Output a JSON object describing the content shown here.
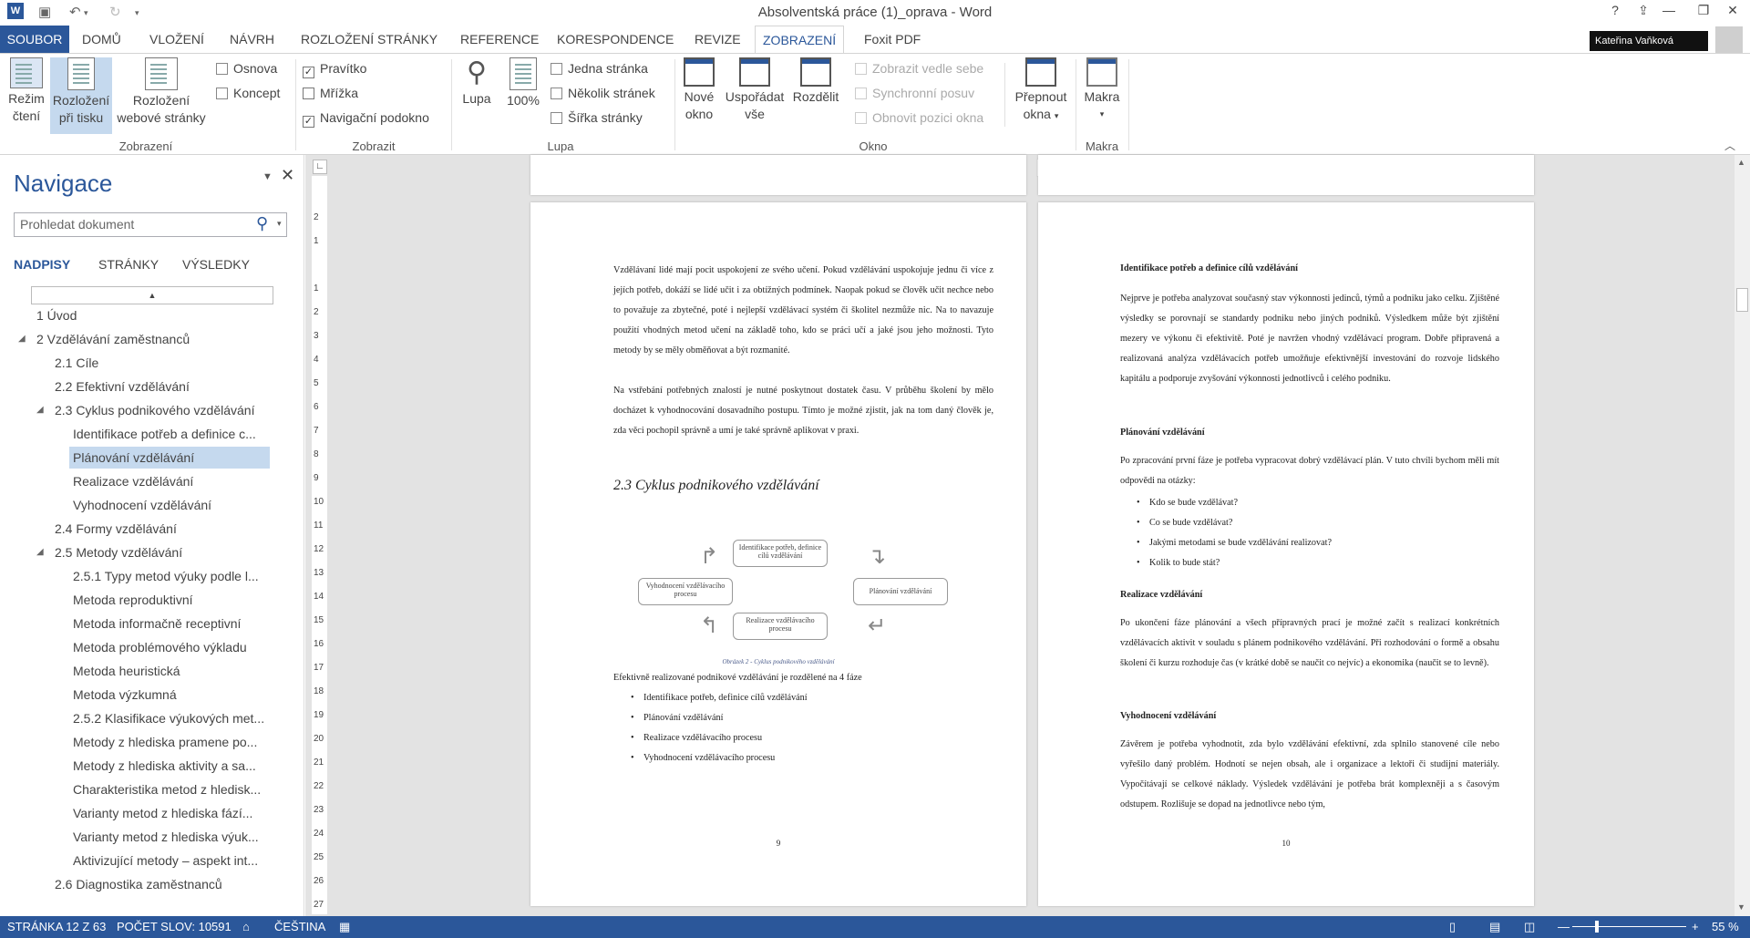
{
  "window": {
    "title": "Absolventská práce (1)_oprava - Word"
  },
  "qat": {
    "undo": "↶",
    "redo": "↻"
  },
  "tabs": [
    "SOUBOR",
    "DOMŮ",
    "VLOŽENÍ",
    "NÁVRH",
    "ROZLOŽENÍ STRÁNKY",
    "REFERENCE",
    "KORESPONDENCE",
    "REVIZE",
    "ZOBRAZENÍ",
    "Foxit PDF"
  ],
  "user": {
    "name": "Kateřina Vaňková"
  },
  "ribbon": {
    "zobrazeni": {
      "read1": "Režim",
      "read2": "čtení",
      "print1": "Rozložení",
      "print2": "při tisku",
      "web1": "Rozložení",
      "web2": "webové stránky",
      "osnova": "Osnova",
      "koncept": "Koncept",
      "label": "Zobrazení"
    },
    "zobrazit": {
      "pravitko": "Pravítko",
      "mrizka": "Mřížka",
      "navig": "Navigační podokno",
      "label": "Zobrazit"
    },
    "lupa": {
      "lupa": "Lupa",
      "pct": "100%",
      "jedna": "Jedna stránka",
      "nekolik": "Několik stránek",
      "sirka": "Šířka stránky",
      "label": "Lupa"
    },
    "okno": {
      "nove1": "Nové",
      "nove2": "okno",
      "usp1": "Uspořádat",
      "usp2": "vše",
      "rozdelit": "Rozdělit",
      "vedle": "Zobrazit vedle sebe",
      "synchro": "Synchronní posuv",
      "obnovit": "Obnovit pozici okna",
      "prep1": "Přepnout",
      "prep2": "okna",
      "label": "Okno"
    },
    "makra": {
      "makra": "Makra",
      "label": "Makra"
    }
  },
  "nav": {
    "title": "Navigace",
    "search_placeholder": "Prohledat dokument",
    "tabs": [
      "NADPISY",
      "STRÁNKY",
      "VÝSLEDKY"
    ],
    "items": [
      {
        "label": "1 Úvod",
        "level": 0
      },
      {
        "label": "2 Vzdělávání zaměstnanců",
        "level": 0
      },
      {
        "label": "2.1 Cíle",
        "level": 1
      },
      {
        "label": "2.2 Efektivní vzdělávání",
        "level": 1
      },
      {
        "label": "2.3 Cyklus podnikového vzdělávání",
        "level": 1
      },
      {
        "label": "Identifikace potřeb a definice c...",
        "level": 2
      },
      {
        "label": "Plánování vzdělávání",
        "level": 2
      },
      {
        "label": "Realizace vzdělávání",
        "level": 2
      },
      {
        "label": "Vyhodnocení vzdělávání",
        "level": 2
      },
      {
        "label": "2.4 Formy vzdělávání",
        "level": 1
      },
      {
        "label": "2.5 Metody vzdělávání",
        "level": 1
      },
      {
        "label": "2.5.1 Typy metod výuky podle l...",
        "level": 2
      },
      {
        "label": "Metoda reproduktivní",
        "level": 2
      },
      {
        "label": "Metoda informačně receptivní",
        "level": 2
      },
      {
        "label": "Metoda problémového výkladu",
        "level": 2
      },
      {
        "label": "Metoda heuristická",
        "level": 2
      },
      {
        "label": "Metoda výzkumná",
        "level": 2
      },
      {
        "label": "2.5.2 Klasifikace výukových met...",
        "level": 2
      },
      {
        "label": "Metody z hlediska pramene po...",
        "level": 2
      },
      {
        "label": "Metody z hlediska aktivity a sa...",
        "level": 2
      },
      {
        "label": "Charakteristika metod z hledisk...",
        "level": 2
      },
      {
        "label": "Varianty metod z hlediska fází...",
        "level": 2
      },
      {
        "label": "Varianty metod z hlediska výuk...",
        "level": 2
      },
      {
        "label": "Aktivizující metody – aspekt int...",
        "level": 2
      },
      {
        "label": "2.6 Diagnostika zaměstnanců",
        "level": 1
      }
    ]
  },
  "page9": {
    "p1": "Vzdělávaní lidé mají pocit uspokojení ze svého učení. Pokud vzdělávání uspokojuje jednu či více z jejích potřeb, dokáží se lidé učit i za obtížných podmínek. Naopak pokud se člověk učit nechce nebo to považuje za zbytečné, poté i nejlepší vzdělávací systém či školitel nezmůže nic. Na to navazuje použití vhodných metod učení na základě toho, kdo se práci učí a jaké jsou jeho možnosti. Tyto metody by se měly obměňovat a být rozmanité.",
    "p2": "Na vstřebání potřebných znalostí je nutné poskytnout dostatek času. V průběhu školení by mělo docházet k vyhodnocování dosavadního postupu. Tímto je možné zjistit, jak na tom daný člověk je, zda věci pochopil správně a umí je také správně aplikovat v praxi.",
    "heading": "2.3 Cyklus podnikového vzdělávání",
    "diag": {
      "b1": "Identifikace potřeb, definice cílů vzdělávání",
      "b2": "Plánování vzdělávání",
      "b3": "Realizace vzdělávacího procesu",
      "b4": "Vyhodnocení vzdělávacího procesu"
    },
    "caption": "Obrázek 2 - Cyklus podnikového vzdělávání",
    "p3": "Efektivně realizované podnikové vzdělávání je rozdělené na 4 fáze",
    "bullets": [
      "Identifikace potřeb, definice cílů vzdělávání",
      "Plánování vzdělávání",
      "Realizace vzdělávacího procesu",
      "Vyhodnocení vzdělávacího procesu"
    ],
    "num": "9"
  },
  "page10": {
    "h1": "Identifikace potřeb a definice cílů vzdělávání",
    "p1": "Nejprve je potřeba analyzovat současný stav výkonnosti jedinců, týmů a podniku jako celku. Zjištěné výsledky se porovnají se standardy podniku nebo jiných podniků. Výsledkem může být zjištění mezery ve výkonu či efektivitě. Poté je navržen vhodný vzdělávací program. Dobře připravená a realizovaná analýza vzdělávacích potřeb umožňuje efektivnější investování do rozvoje lidského kapitálu a podporuje zvyšování výkonnosti jednotlivců i celého podniku.",
    "h2": "Plánování vzdělávání",
    "p2": "Po zpracování první fáze je potřeba vypracovat dobrý vzdělávací plán. V tuto chvíli bychom měli mít odpovědi na otázky:",
    "bullets": [
      "Kdo se bude vzdělávat?",
      "Co se bude vzdělávat?",
      "Jakými metodami se bude vzdělávání realizovat?",
      "Kolik to bude stát?"
    ],
    "h3": "Realizace vzdělávání",
    "p3": "Po ukončení fáze plánování a všech přípravných prací je možné začít s realizací konkrétních vzdělávacích aktivit v souladu s plánem podnikového vzdělávání. Při rozhodování o formě a obsahu školení či kurzu rozhoduje čas (v krátké době se naučit co nejvíc) a ekonomika (naučit se to levně).",
    "h4": "Vyhodnocení vzdělávání",
    "p4": "Závěrem je potřeba vyhodnotit, zda bylo vzdělávání efektivní, zda splnilo stanovené cíle nebo vyřešilo daný problém. Hodnotí se nejen obsah, ale i organizace a lektoři či studijní materiály. Vypočítávají se celkové náklady. Výsledek vzdělávání je potřeba brát komplexněji a s časovým odstupem. Rozlišuje se dopad na jednotlivce nebo tým,",
    "num": "10"
  },
  "ruler": {
    "h": [
      "3",
      "2",
      "1",
      "",
      "1",
      "2",
      "3",
      "4",
      "5",
      "6",
      "7",
      "8",
      "9",
      "10",
      "11",
      "12",
      "13",
      "14",
      "15",
      "",
      "17"
    ]
  },
  "vruler": [
    "2",
    "1",
    "",
    "1",
    "2",
    "3",
    "4",
    "5",
    "6",
    "7",
    "8",
    "9",
    "10",
    "11",
    "12",
    "13",
    "14",
    "15",
    "16",
    "17",
    "18",
    "19",
    "20",
    "21",
    "22",
    "23",
    "24",
    "25",
    "26",
    "27"
  ],
  "status": {
    "page": "STRÁNKA 12 Z 63",
    "words": "POČET SLOV: 10591",
    "lang": "ČEŠTINA",
    "zoom": "55 %"
  }
}
